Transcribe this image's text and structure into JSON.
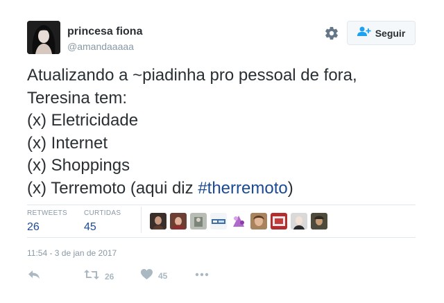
{
  "user": {
    "name": "princesa fiona",
    "handle": "@amandaaaaa"
  },
  "follow_button": {
    "label": "Seguir"
  },
  "tweet": {
    "lines": [
      "Atualizando a ~piadinha pro pessoal de fora,",
      "Teresina tem:",
      "(x) Eletricidade",
      "(x) Internet",
      "(x) Shoppings"
    ],
    "last_line_prefix": "(x) Terremoto (aqui diz ",
    "hashtag": "#therremoto",
    "last_line_suffix": ")"
  },
  "stats": {
    "retweets_label": "RETWEETS",
    "retweets_value": "26",
    "likes_label": "CURTIDAS",
    "likes_value": "45"
  },
  "timestamp": "11:54 - 3 de jan de 2017",
  "actions": {
    "retweet_count": "26",
    "like_count": "45"
  },
  "colors": {
    "link": "#1b4a93",
    "muted": "#8899a6",
    "border": "#e1e8ed",
    "action_icon": "#aab8c2"
  },
  "icons": {
    "gear": "gear-icon",
    "follow": "person-add-icon",
    "reply": "reply-icon",
    "retweet": "retweet-icon",
    "like": "heart-icon",
    "more": "more-icon"
  }
}
